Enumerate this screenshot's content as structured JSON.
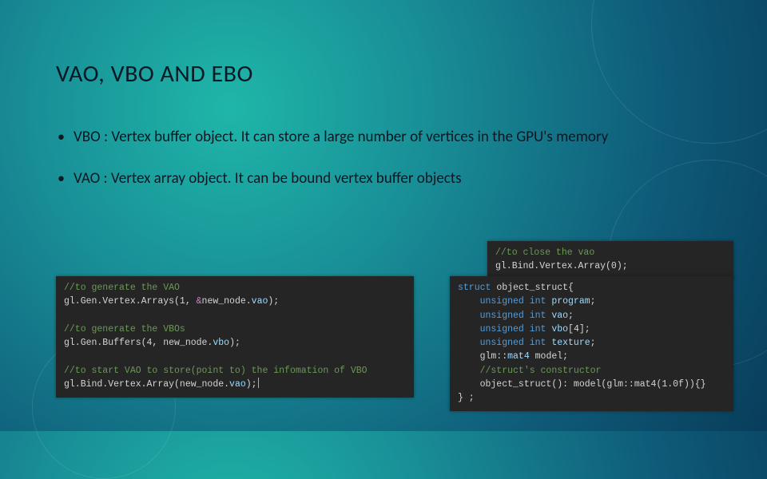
{
  "title": "VAO, VBO AND EBO",
  "bullets": [
    "VBO : Vertex buffer object. It can store a large number of vertices in the GPU's memory",
    "VAO : Vertex array object. It can be bound vertex buffer objects"
  ],
  "code_top": {
    "c1": "//to close the vao",
    "l1": "gl.Bind.Vertex.Array(0);"
  },
  "code_left": {
    "c1": "//to generate the VAO",
    "l1a": "gl.Gen.Vertex.Arrays(1, ",
    "l1amp": "&",
    "l1b": "new_node.",
    "l1c": "vao",
    "l1d": ");",
    "c2": "//to generate the VBOs",
    "l2a": "gl.Gen.Buffers(4, new_node.",
    "l2b": "vbo",
    "l2c": ");",
    "c3": "//to start VAO to store(point to) the infomation of VBO",
    "l3a": "gl.Bind.Vertex.Array(new_node.",
    "l3b": "vao",
    "l3c": ");"
  },
  "code_right": {
    "kw_struct": "struct",
    "name": " object_struct",
    "brace_open": "{",
    "m1a": "    unsigned int ",
    "m1b": "program",
    "m1c": ";",
    "m2a": "    unsigned int ",
    "m2b": "vao",
    "m2c": ";",
    "m3a": "    unsigned int ",
    "m3b": "vbo",
    "m3c": "[4];",
    "m4a": "    unsigned int ",
    "m4b": "texture",
    "m4c": ";",
    "m5a": "    glm::",
    "m5b": "mat4",
    "m5c": " model;",
    "c1": "    //struct's constructor",
    "m6": "    object_struct(): model(glm::mat4(1.0f)){}",
    "brace_close": "} ;"
  }
}
